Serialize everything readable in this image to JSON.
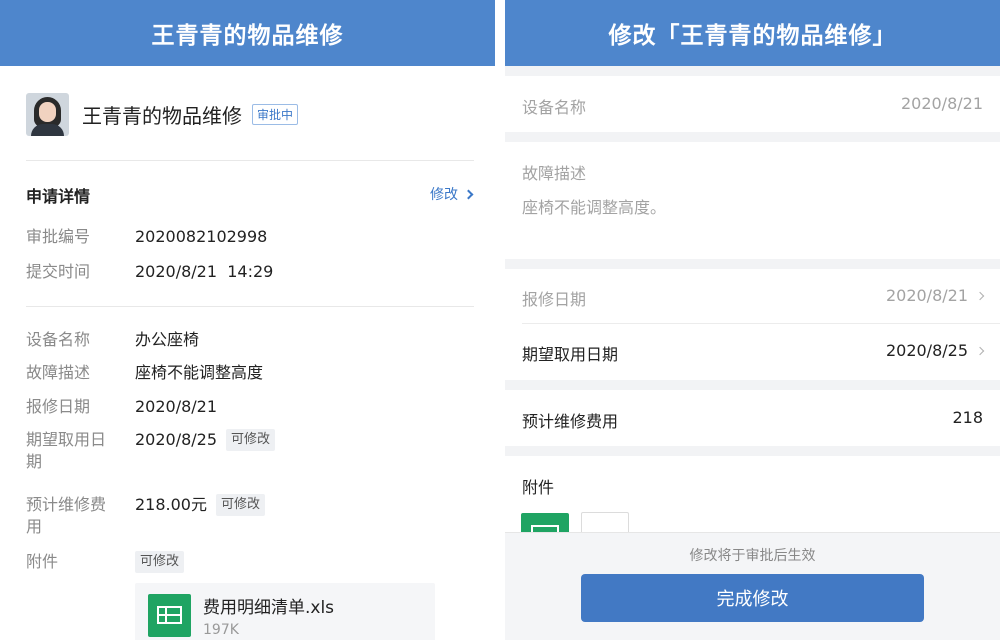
{
  "left": {
    "header_title": "王青青的物品维修",
    "profile": {
      "name": "王青青的物品维修",
      "status": "审批中"
    },
    "details": {
      "title": "申请详情",
      "edit_label": "修改",
      "approval_no_label": "审批编号",
      "approval_no": "2020082102998",
      "submit_time_label": "提交时间",
      "submit_time": "2020/8/21  14:29"
    },
    "fields": {
      "device_label": "设备名称",
      "device": "办公座椅",
      "fault_label": "故障描述",
      "fault": "座椅不能调整高度",
      "repair_date_label": "报修日期",
      "repair_date": "2020/8/21",
      "expected_date_label_1": "期望取用日",
      "expected_date_label_2": "期",
      "expected_date": "2020/8/25",
      "cost_label_1": "预计维修费",
      "cost_label_2": "用",
      "cost": "218.00元",
      "attachment_label": "附件",
      "editable_tag": "可修改"
    },
    "file": {
      "name": "费用明细清单.xls",
      "size": "197K"
    }
  },
  "right": {
    "header_title": "修改「王青青的物品维修」",
    "device_label": "设备名称",
    "device_value": "2020/8/21",
    "fault_label": "故障描述",
    "fault_value": "座椅不能调整高度。",
    "repair_date_label": "报修日期",
    "repair_date_value": "2020/8/21",
    "expected_date_label": "期望取用日期",
    "expected_date_value": "2020/8/25",
    "cost_label": "预计维修费用",
    "cost_value": "218",
    "attachment_label": "附件",
    "footer_note": "修改将于审批后生效",
    "done_button": "完成修改"
  },
  "colors": {
    "header": "#4e86cc",
    "accent": "#3b78c8",
    "button": "#4279c4",
    "file_green": "#1fa463"
  }
}
